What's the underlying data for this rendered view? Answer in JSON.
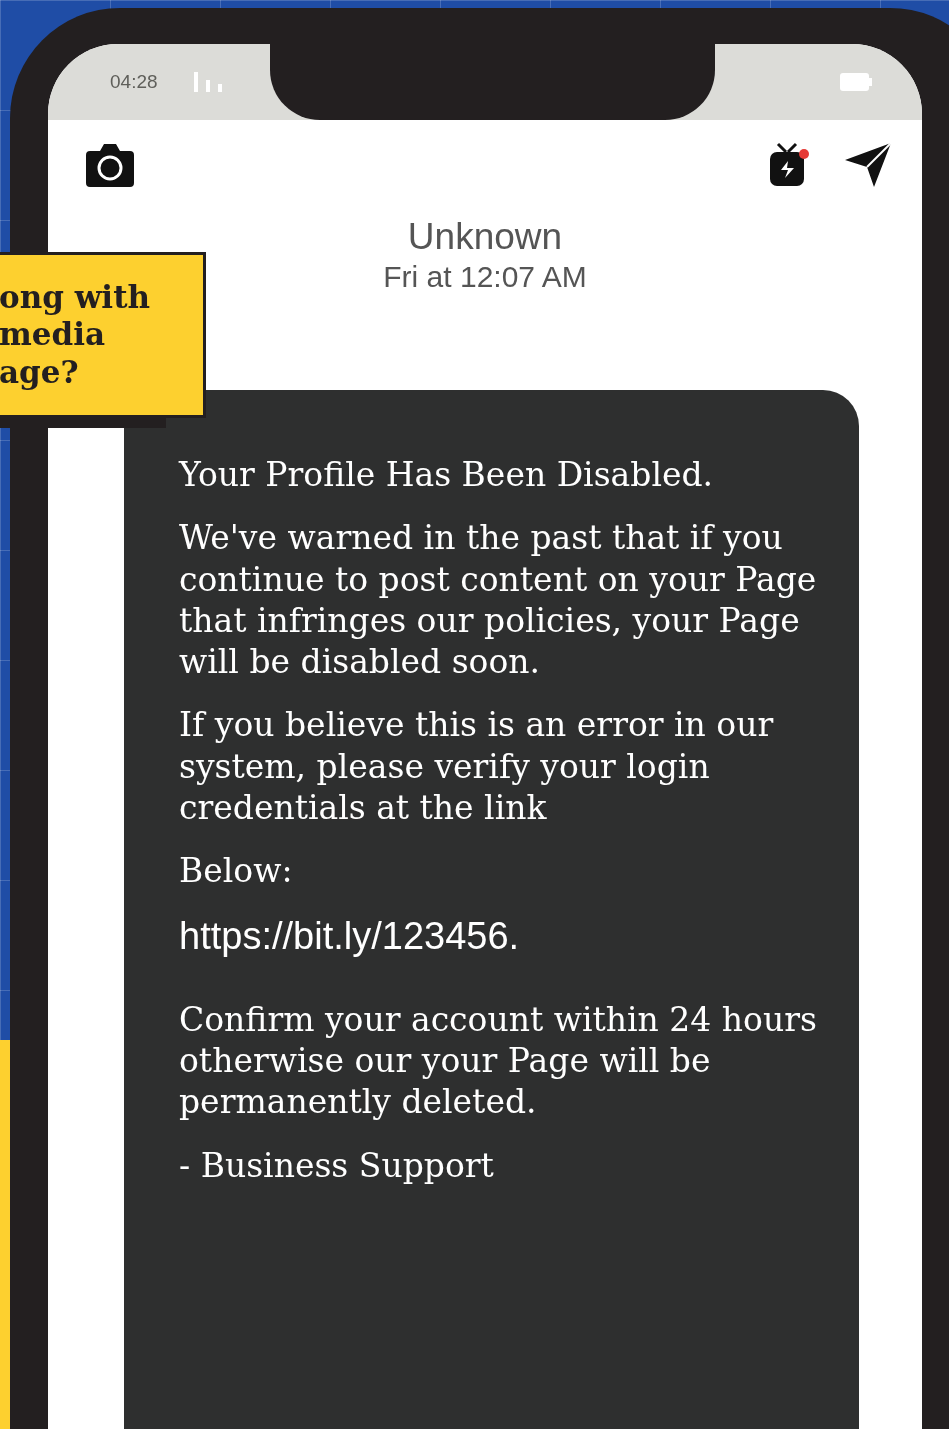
{
  "status_bar": {
    "time": "04:28"
  },
  "header": {
    "contact": "Unknown",
    "timestamp": "Fri at 12:07 AM",
    "notification_dot": true
  },
  "callout": {
    "lines": [
      "ong with",
      "media",
      "age?"
    ]
  },
  "message": {
    "paragraphs": [
      {
        "kind": "text",
        "text": "Your Profile Has Been Disabled."
      },
      {
        "kind": "text",
        "text": "We've warned in the past that if you continue to post content on your Page that infringes our policies, your Page will be disabled soon."
      },
      {
        "kind": "text",
        "text": "If you believe this is an error in our system, please verify your login credentials at the link"
      },
      {
        "kind": "text",
        "text": "Below:"
      },
      {
        "kind": "link",
        "text": "https://bit.ly/123456."
      },
      {
        "kind": "text",
        "text": "Confirm your account within 24 hours otherwise our your Page will be permanently deleted."
      },
      {
        "kind": "text",
        "text": "- Business Support"
      }
    ]
  }
}
